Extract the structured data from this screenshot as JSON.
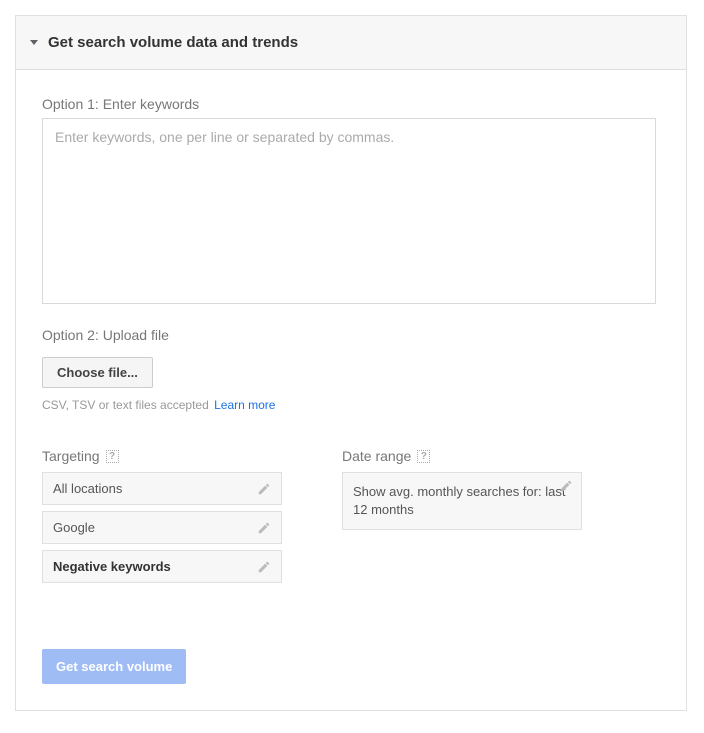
{
  "header": {
    "title": "Get search volume data and trends"
  },
  "option1": {
    "label": "Option 1: Enter keywords",
    "placeholder": "Enter keywords, one per line or separated by commas."
  },
  "option2": {
    "label": "Option 2: Upload file",
    "button": "Choose file...",
    "hint": "CSV, TSV or text files accepted",
    "learn_more": "Learn more"
  },
  "targeting": {
    "label": "Targeting",
    "locations": "All locations",
    "network": "Google",
    "negative": "Negative keywords"
  },
  "date_range": {
    "label": "Date range",
    "text": "Show avg. monthly searches for: last 12 months"
  },
  "submit": {
    "label": "Get search volume"
  }
}
